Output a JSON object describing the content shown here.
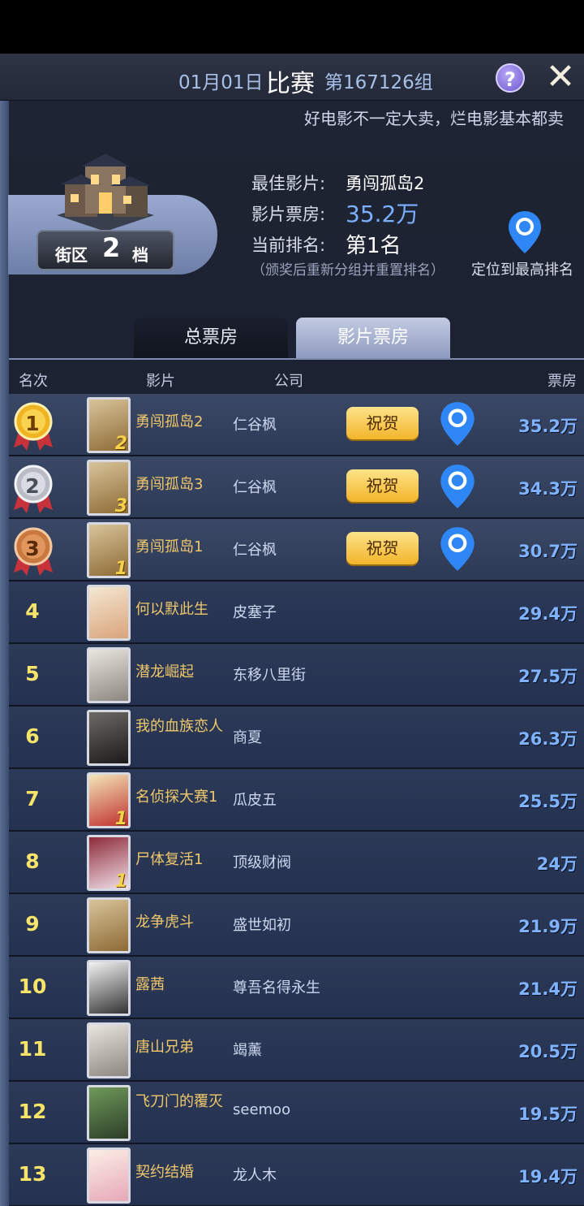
{
  "header": {
    "date": "01月01日",
    "match_title": "比赛",
    "group": "第167126组",
    "help_icon": "?",
    "close_icon": "✕"
  },
  "marquee": "好电影不一定大卖，烂电影基本都卖",
  "district": {
    "label_left": "街区",
    "level": "2",
    "label_right": "档"
  },
  "info": {
    "best_film_label": "最佳影片:",
    "best_film_value": "勇闯孤岛2",
    "box_office_label": "影片票房:",
    "box_office_value": "35.2万",
    "rank_label": "当前排名:",
    "rank_value": "第1名",
    "note": "（颁奖后重新分组并重置排名）",
    "locate_label": "定位到最高排名"
  },
  "tabs": [
    {
      "label": "总票房",
      "active": false
    },
    {
      "label": "影片票房",
      "active": true
    }
  ],
  "columns": {
    "rank": "名次",
    "film": "影片",
    "company": "公司",
    "box_office": "票房"
  },
  "congrats_label": "祝贺",
  "rows": [
    {
      "rank": "1",
      "film": "勇闯孤岛2",
      "company": "仁谷枫",
      "box_office": "35.2万",
      "seq": "2",
      "medal": "gold"
    },
    {
      "rank": "2",
      "film": "勇闯孤岛3",
      "company": "仁谷枫",
      "box_office": "34.3万",
      "seq": "3",
      "medal": "silver"
    },
    {
      "rank": "3",
      "film": "勇闯孤岛1",
      "company": "仁谷枫",
      "box_office": "30.7万",
      "seq": "1",
      "medal": "bronze"
    },
    {
      "rank": "4",
      "film": "何以默此生",
      "company": "皮塞子",
      "box_office": "29.4万",
      "seq": ""
    },
    {
      "rank": "5",
      "film": "潜龙崛起",
      "company": "东移八里街",
      "box_office": "27.5万",
      "seq": ""
    },
    {
      "rank": "6",
      "film": "我的血族恋人",
      "company": "商夏",
      "box_office": "26.3万",
      "seq": ""
    },
    {
      "rank": "7",
      "film": "名侦探大赛1",
      "company": "瓜皮五",
      "box_office": "25.5万",
      "seq": "1"
    },
    {
      "rank": "8",
      "film": "尸体复活1",
      "company": "顶级财阀",
      "box_office": "24万",
      "seq": "1"
    },
    {
      "rank": "9",
      "film": "龙争虎斗",
      "company": "盛世如初",
      "box_office": "21.9万",
      "seq": ""
    },
    {
      "rank": "10",
      "film": "露茜",
      "company": "尊吾名得永生",
      "box_office": "21.4万",
      "seq": ""
    },
    {
      "rank": "11",
      "film": "唐山兄弟",
      "company": "竭薰",
      "box_office": "20.5万",
      "seq": ""
    },
    {
      "rank": "12",
      "film": "飞刀门的覆灭",
      "company": "seemoo",
      "box_office": "19.5万",
      "seq": ""
    },
    {
      "rank": "13",
      "film": "契约结婚",
      "company": "龙人木",
      "box_office": "19.4万",
      "seq": ""
    }
  ],
  "colors": {
    "rank_yellow": "#f7e469",
    "film_gold": "#f0c86b",
    "box_blue": "#7fb3ff",
    "pin_blue": "#2f86f5"
  }
}
